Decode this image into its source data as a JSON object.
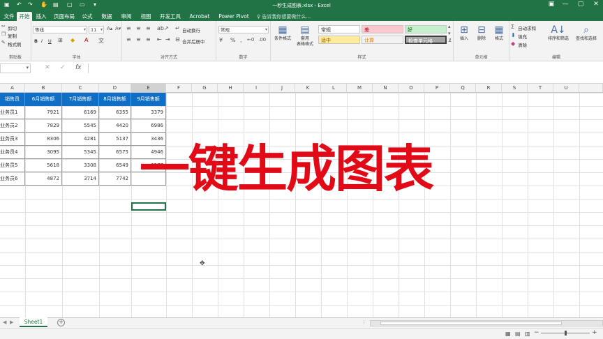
{
  "window": {
    "title": "一秒生成图表.xlsx - Excel"
  },
  "tabs": [
    {
      "label": "文件"
    },
    {
      "label": "开始"
    },
    {
      "label": "插入"
    },
    {
      "label": "页面布局"
    },
    {
      "label": "公式"
    },
    {
      "label": "数据"
    },
    {
      "label": "审阅"
    },
    {
      "label": "视图"
    },
    {
      "label": "开发工具"
    },
    {
      "label": "Acrobat"
    },
    {
      "label": "Power Pivot"
    }
  ],
  "tellme": "告诉我你想要做什么...",
  "ribbon": {
    "clipboard": {
      "cut": "剪切",
      "copy": "复制",
      "format_painter": "格式刷",
      "label": "剪贴板"
    },
    "font": {
      "name": "等线",
      "size": "11",
      "label": "字体",
      "bold": "B",
      "italic": "I",
      "underline": "U"
    },
    "alignment": {
      "wrap": "自动换行",
      "merge": "合并后居中",
      "label": "对齐方式"
    },
    "number": {
      "format": "常规",
      "label": "数字"
    },
    "styles": {
      "conditional": "条件格式",
      "table": "套用\n表格格式",
      "normal": "常规",
      "bad": "差",
      "good": "好",
      "neutral": "适中",
      "calc": "计算",
      "check": "检查单元格",
      "label": "样式"
    },
    "cells": {
      "insert": "插入",
      "delete": "删除",
      "format": "格式",
      "label": "单元格"
    },
    "editing": {
      "autosum": "自动求和",
      "fill": "填充",
      "clear": "清除",
      "sort": "排序和筛选",
      "find": "查找和选择",
      "label": "编辑"
    }
  },
  "formula_bar": {
    "fx": "fx",
    "cancel": "✕",
    "enter": "✓"
  },
  "columns": [
    "A",
    "B",
    "C",
    "D",
    "E",
    "F",
    "G",
    "H",
    "I",
    "J",
    "K",
    "L",
    "M",
    "N",
    "O",
    "P",
    "Q",
    "R",
    "S",
    "T",
    "U"
  ],
  "table": {
    "headers": [
      "销售员",
      "6月销售额",
      "7月销售额",
      "8月销售额",
      "9月销售额"
    ],
    "rows": [
      [
        "业务员1",
        "7921",
        "6169",
        "6355",
        "3379"
      ],
      [
        "业务员2",
        "7829",
        "5545",
        "4420",
        "6986"
      ],
      [
        "业务员3",
        "8306",
        "4281",
        "5137",
        "3436"
      ],
      [
        "业务员4",
        "3095",
        "5345",
        "6575",
        "4946"
      ],
      [
        "业务员5",
        "5618",
        "3308",
        "6549",
        "6577"
      ],
      [
        "业务员6",
        "4872",
        "3714",
        "7742",
        ""
      ]
    ]
  },
  "overlay_title": "一键生成图表",
  "sheets": [
    {
      "name": "Sheet1"
    }
  ],
  "colors": {
    "excel_green": "#217346",
    "header_blue": "#0f6fc6",
    "title_red": "#e30a17"
  }
}
